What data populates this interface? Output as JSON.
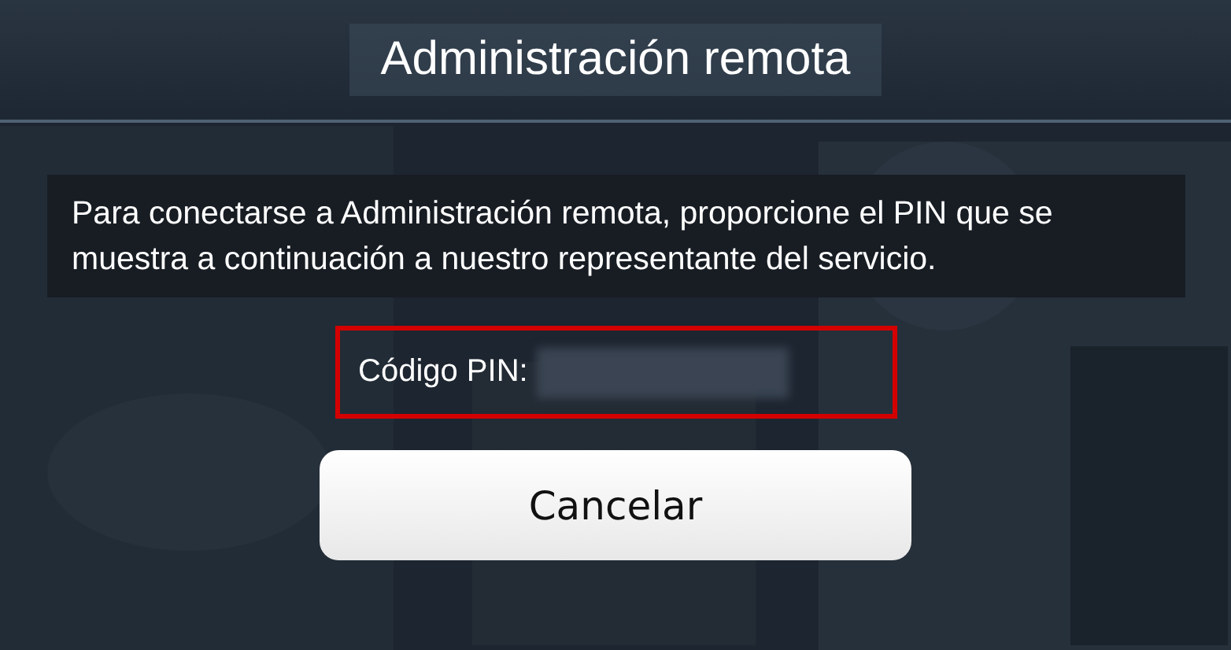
{
  "window": {
    "title": "Administración remota"
  },
  "message": "Para conectarse a Administración remota, proporcione el PIN que se muestra a continuación a nuestro representante del servicio.",
  "pin": {
    "label": "Código PIN:",
    "highlighted": true
  },
  "buttons": [
    {
      "label": "Cancelar"
    }
  ]
}
